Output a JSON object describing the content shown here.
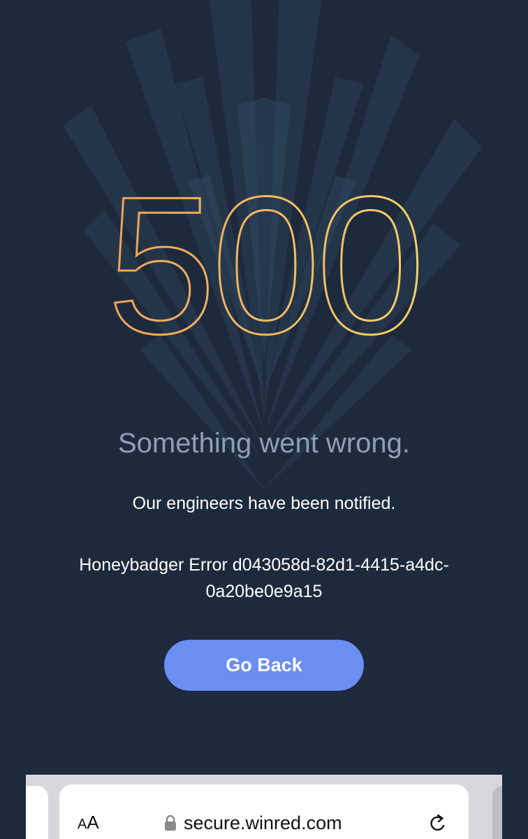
{
  "error": {
    "code": "500",
    "headline": "Something went wrong.",
    "message": "Our engineers have been notified.",
    "error_reference": "Honeybadger Error d043058d-82d1-4415-a4dc-0a20be0e9a15"
  },
  "actions": {
    "go_back_label": "Go Back"
  },
  "browser": {
    "reader_button_large": "A",
    "reader_button_small": "A",
    "url": "secure.winred.com",
    "lock_icon": "lock-icon",
    "reload_icon": "reload-icon"
  },
  "colors": {
    "background": "#1d2a3c",
    "button": "#6b8ef2",
    "headline_text": "#8da0b6",
    "code_gradient_start": "#f0a05a",
    "code_gradient_end": "#f5d068"
  }
}
